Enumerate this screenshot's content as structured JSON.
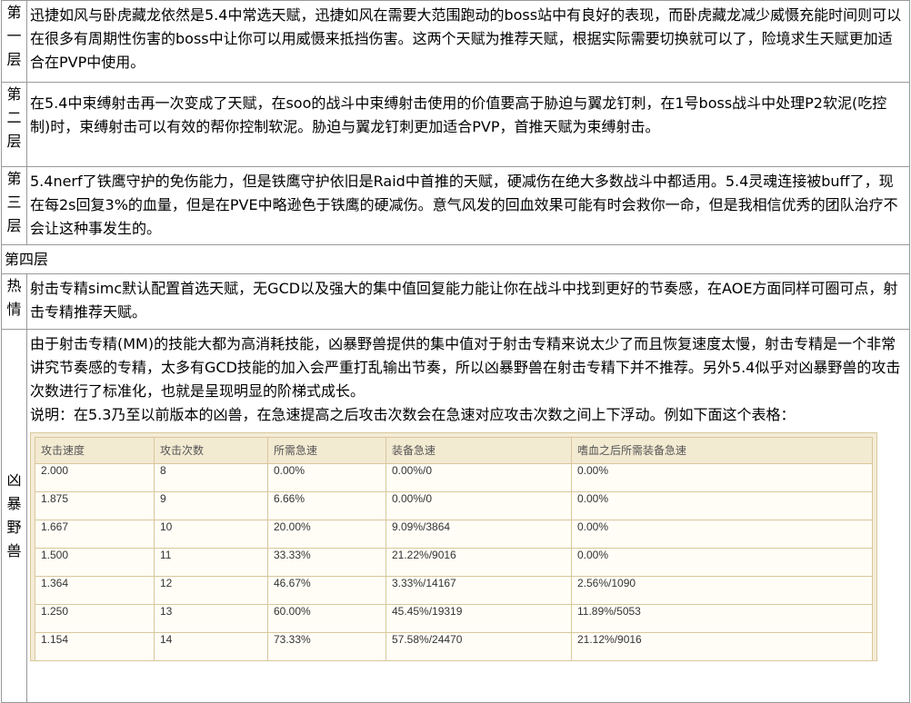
{
  "rows": [
    {
      "label_chars": [
        "第",
        "一",
        "层"
      ],
      "text": "迅捷如风与卧虎藏龙依然是5.4中常选天赋，迅捷如风在需要大范围跑动的boss站中有良好的表现，而卧虎藏龙减少威慑充能时间则可以在很多有周期性伤害的boss中让你可以用威慑来抵挡伤害。这两个天赋为推荐天赋，根据实际需要切换就可以了，险境求生天赋更加适合在PVP中使用。"
    },
    {
      "label_chars": [
        "第",
        "二",
        "层"
      ],
      "text": "在5.4中束缚射击再一次变成了天赋，在soo的战斗中束缚射击使用的价值要高于胁迫与翼龙钉刺，在1号boss战斗中处理P2软泥(吃控制)时，束缚射击可以有效的帮你控制软泥。胁迫与翼龙钉刺更加适合PVP，首推天赋为束缚射击。"
    },
    {
      "label_chars": [
        "第",
        "三",
        "层"
      ],
      "text": "5.4nerf了铁鹰守护的免伤能力，但是铁鹰守护依旧是Raid中首推的天赋，硬减伤在绝大多数战斗中都适用。5.4灵魂连接被buff了，现在每2s回复3%的血量，但是在PVE中略逊色于铁鹰的硬减伤。意气风发的回血效果可能有时会救你一命，但是我相信优秀的团队治疗不会让这种事发生的。"
    }
  ],
  "row4": {
    "text": "第四层"
  },
  "row5": {
    "label_chars": [
      "热",
      "情"
    ],
    "text": "射击专精simc默认配置首选天赋，无GCD以及强大的集中值回复能力能让你在战斗中找到更好的节奏感，在AOE方面同样可圈可点，射击专精推荐天赋。"
  },
  "row6": {
    "label_chars": [
      "凶",
      "暴",
      "野",
      "兽"
    ],
    "para1": "由于射击专精(MM)的技能大都为高消耗技能，凶暴野兽提供的集中值对于射击专精来说太少了而且恢复速度太慢，射击专精是一个非常讲究节奏感的专精，太多有GCD技能的加入会严重打乱输出节奏，所以凶暴野兽在射击专精下并不推荐。另外5.4似乎对凶暴野兽的攻击次数进行了标准化，也就是呈现明显的阶梯式成长。",
    "para2": "说明：在5.3乃至以前版本的凶兽，在急速提高之后攻击次数会在急速对应攻击次数之间上下浮动。例如下面这个表格：",
    "table": {
      "headers": [
        "攻击速度",
        "攻击次数",
        "所需急速",
        "装备急速",
        "嗜血之后所需装备急速"
      ],
      "rows": [
        [
          "2.000",
          "8",
          "0.00%",
          "0.00%/0",
          "0.00%"
        ],
        [
          "1.875",
          "9",
          "6.66%",
          "0.00%/0",
          "0.00%"
        ],
        [
          "1.667",
          "10",
          "20.00%",
          "9.09%/3864",
          "0.00%"
        ],
        [
          "1.500",
          "11",
          "33.33%",
          "21.22%/9016",
          "0.00%"
        ],
        [
          "1.364",
          "12",
          "46.67%",
          "3.33%/14167",
          "2.56%/1090"
        ],
        [
          "1.250",
          "13",
          "60.00%",
          "45.45%/19319",
          "11.89%/5053"
        ],
        [
          "1.154",
          "14",
          "73.33%",
          "57.58%/24470",
          "21.12%/9016"
        ]
      ]
    }
  }
}
